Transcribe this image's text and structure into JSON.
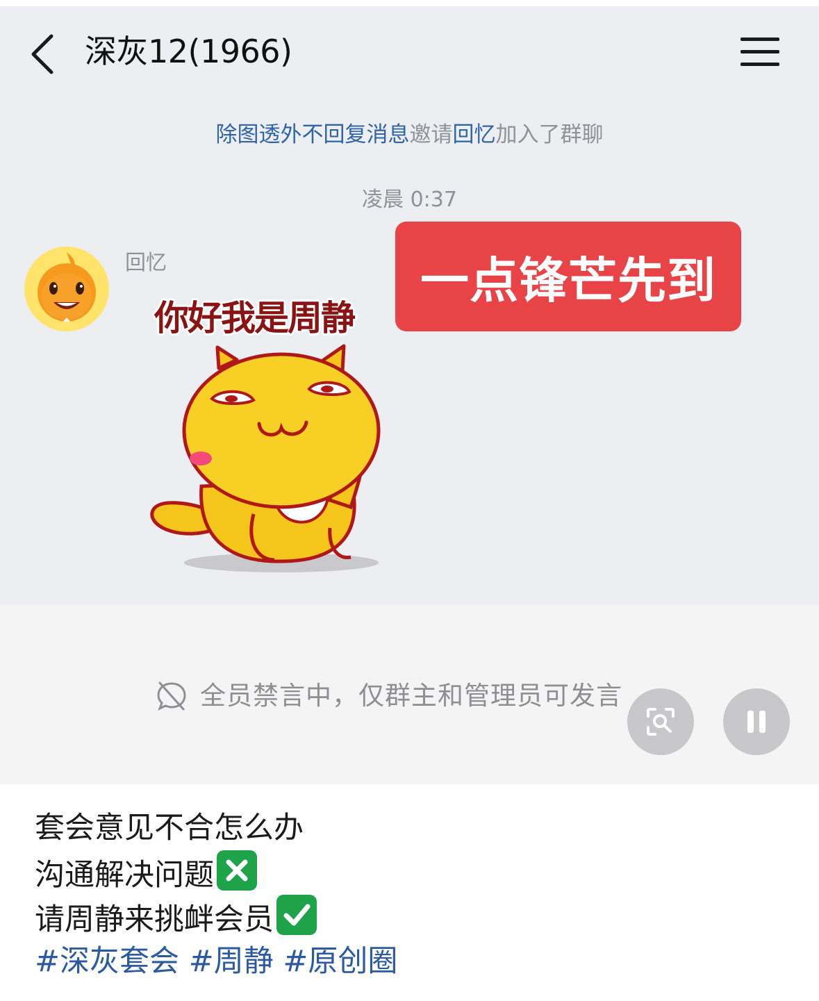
{
  "header": {
    "title": "深灰12(1966)",
    "back_icon": "chevron-left-icon",
    "menu_icon": "hamburger-menu-icon"
  },
  "system_message": {
    "inviter": "除图透外不回复消息",
    "verb": "邀请",
    "invitee": "回忆",
    "suffix": "加入了群聊"
  },
  "timestamp": "凌晨 0:37",
  "message": {
    "sender_name": "回忆",
    "sticker_caption": "你好我是周静"
  },
  "banner": {
    "text": "一点锋芒先到",
    "color": "#e84347"
  },
  "input_bar": {
    "muted_notice": "全员禁言中，仅群主和管理员可发言",
    "muted_icon": "no-chat-icon"
  },
  "floating_buttons": {
    "scan_icon": "scan-search-icon",
    "pause_icon": "pause-icon"
  },
  "post_caption": {
    "line1": "套会意见不合怎么办",
    "line2": "沟通解决问题",
    "line3": "请周静来挑衅会员",
    "line2_emoji": "cross-mark-icon",
    "line3_emoji": "check-mark-icon",
    "tags": [
      "#深灰套会",
      "#周静",
      "#原创圈"
    ]
  },
  "colors": {
    "link_blue": "#2f64a8",
    "tag_blue": "#2c5aa0",
    "emoji_green": "#1fa34a",
    "chat_bg": "#edeef1"
  }
}
